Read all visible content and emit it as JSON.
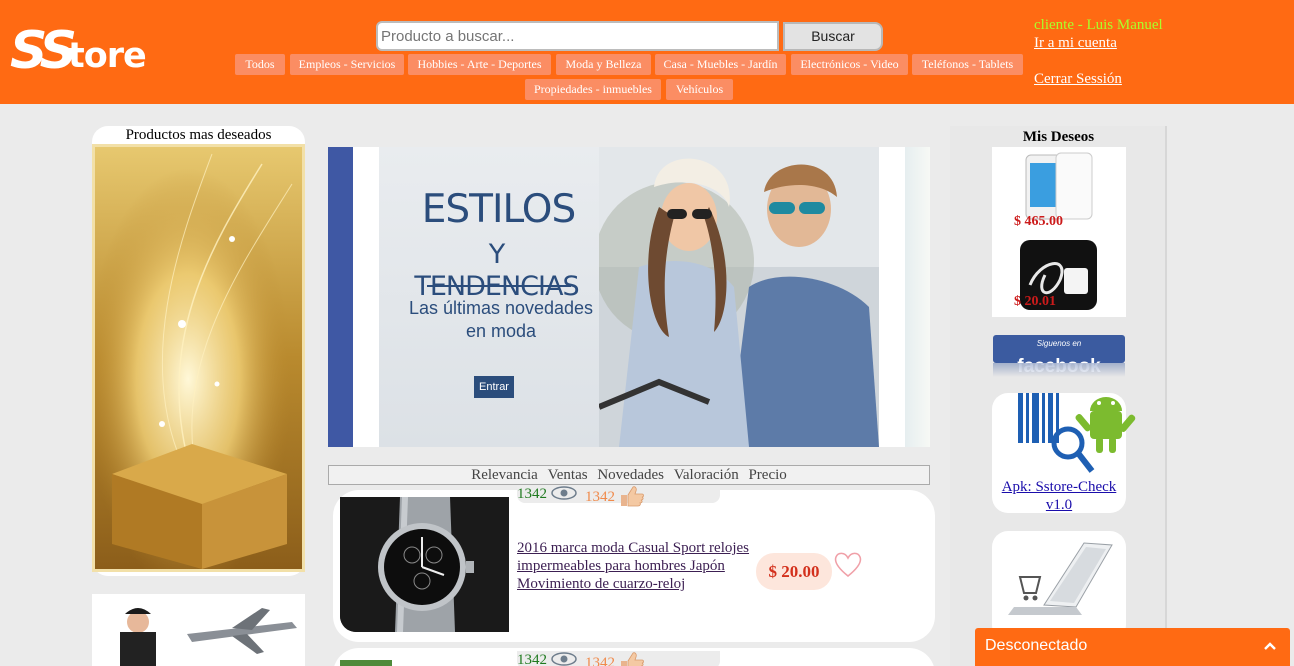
{
  "header": {
    "logo_text": "SStore",
    "search_placeholder": "Producto a buscar...",
    "search_button": "Buscar",
    "categories": [
      "Todos",
      "Empleos - Servicios",
      "Hobbies - Arte - Deportes",
      "Moda y Belleza",
      "Casa - Muebles - Jardín",
      "Electrónicos - Video",
      "Teléfonos - Tablets",
      "Propiedades - inmuebles",
      "Vehículos"
    ],
    "user": {
      "greeting": "cliente - Luis Manuel",
      "account_link": "Ir a mi cuenta",
      "logout_link": "Cerrar Sessión"
    }
  },
  "left_sidebar": {
    "title": "Productos mas deseados"
  },
  "banner": {
    "headline": "ESTILOS",
    "headline2": "Y TENDENCIAS",
    "subtitle": "Las últimas novedades en moda",
    "button": "Entrar"
  },
  "sort_bar": {
    "options": [
      "Relevancia",
      "Ventas",
      "Novedades",
      "Valoración",
      "Precio"
    ]
  },
  "products": [
    {
      "views": "1342",
      "likes": "1342",
      "title": "2016 marca moda Casual Sport relojes impermeables para hombres Japón Movimiento de cuarzo-reloj",
      "price": "$ 20.00"
    },
    {
      "views": "1342",
      "likes": "1342"
    }
  ],
  "right_sidebar": {
    "wishlist_title": "Mis Deseos",
    "wish_items": [
      {
        "price": "$ 465.00"
      },
      {
        "price": "$ 20.01"
      }
    ],
    "facebook_label": "facebook",
    "facebook_prefix": "Siguenos en",
    "apk_link": "Apk: Sstore-Check v1.0"
  },
  "chat": {
    "status": "Desconectado"
  },
  "colors": {
    "brand_orange": "#ff6a13",
    "category_bg": "#fb8d63",
    "price_red": "#d3301c",
    "user_green": "#aaff2a"
  }
}
